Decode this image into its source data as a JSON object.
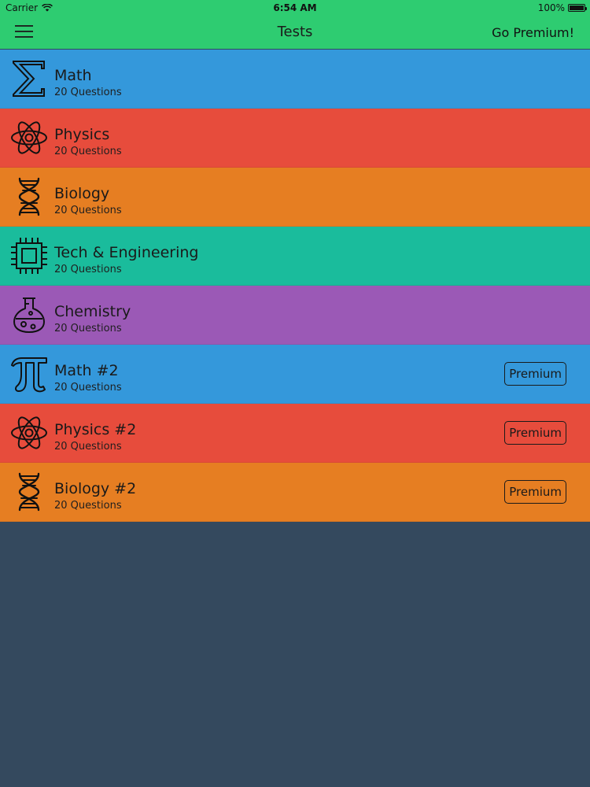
{
  "status_bar": {
    "carrier": "Carrier",
    "time": "6:54 AM",
    "battery_percent": "100%"
  },
  "nav": {
    "title": "Tests",
    "premium_button": "Go Premium!",
    "menu_icon": "hamburger-menu-icon"
  },
  "colors": {
    "nav_green": "#2ecc71",
    "blue": "#3498db",
    "red": "#e74c3c",
    "orange": "#e67e22",
    "teal": "#1abc9c",
    "purple": "#9b59b6",
    "background": "#34495e"
  },
  "tests": [
    {
      "title": "Math",
      "subtitle": "20 Questions",
      "icon": "sigma-icon",
      "color": "#3498db",
      "premium": ""
    },
    {
      "title": "Physics",
      "subtitle": "20 Questions",
      "icon": "atom-icon",
      "color": "#e74c3c",
      "premium": ""
    },
    {
      "title": "Biology",
      "subtitle": "20 Questions",
      "icon": "dna-icon",
      "color": "#e67e22",
      "premium": ""
    },
    {
      "title": "Tech & Engineering",
      "subtitle": "20 Questions",
      "icon": "chip-icon",
      "color": "#1abc9c",
      "premium": ""
    },
    {
      "title": "Chemistry",
      "subtitle": "20 Questions",
      "icon": "flask-icon",
      "color": "#9b59b6",
      "premium": ""
    },
    {
      "title": "Math #2",
      "subtitle": "20 Questions",
      "icon": "pi-icon",
      "color": "#3498db",
      "premium": "Premium"
    },
    {
      "title": "Physics #2",
      "subtitle": "20 Questions",
      "icon": "atom-icon",
      "color": "#e74c3c",
      "premium": "Premium"
    },
    {
      "title": "Biology #2",
      "subtitle": "20 Questions",
      "icon": "dna-icon",
      "color": "#e67e22",
      "premium": "Premium"
    }
  ]
}
